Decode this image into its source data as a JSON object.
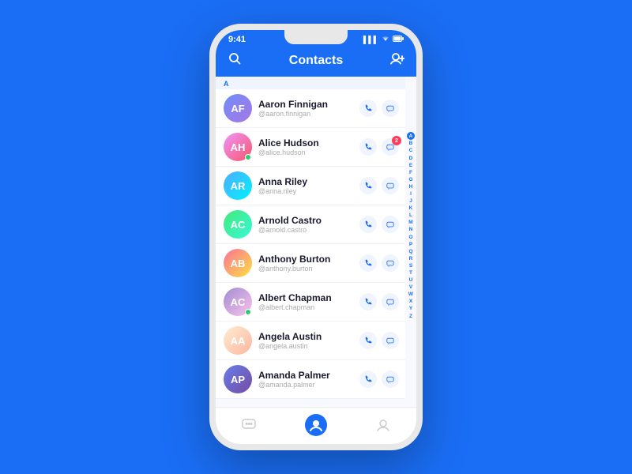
{
  "app": {
    "title": "Contacts"
  },
  "status_bar": {
    "time": "9:41",
    "signal": "▌▌▌",
    "wifi": "WiFi",
    "battery": "🔋"
  },
  "header": {
    "search_icon": "🔍",
    "add_icon": "👤+"
  },
  "contacts": [
    {
      "id": 1,
      "name": "Aaron Finnigan",
      "handle": "@aaron.finnigan",
      "online": false,
      "avatar_letter": "AF",
      "avatar_class": "av-1",
      "badge": null,
      "section": "A"
    },
    {
      "id": 2,
      "name": "Alice Hudson",
      "handle": "@alice.hudson",
      "online": true,
      "avatar_letter": "AH",
      "avatar_class": "av-2",
      "badge": "2",
      "section": null
    },
    {
      "id": 3,
      "name": "Anna Riley",
      "handle": "@anna.riley",
      "online": false,
      "avatar_letter": "AR",
      "avatar_class": "av-3",
      "badge": null,
      "section": null
    },
    {
      "id": 4,
      "name": "Arnold Castro",
      "handle": "@arnold.castro",
      "online": false,
      "avatar_letter": "AC",
      "avatar_class": "av-4",
      "badge": null,
      "section": null
    },
    {
      "id": 5,
      "name": "Anthony Burton",
      "handle": "@anthony.burton",
      "online": false,
      "avatar_letter": "AB",
      "avatar_class": "av-5",
      "badge": null,
      "section": null
    },
    {
      "id": 6,
      "name": "Albert Chapman",
      "handle": "@albert.chapman",
      "online": true,
      "avatar_letter": "AC",
      "avatar_class": "av-6",
      "badge": null,
      "section": null
    },
    {
      "id": 7,
      "name": "Angela Austin",
      "handle": "@angela.austin",
      "online": false,
      "avatar_letter": "AA",
      "avatar_class": "av-7",
      "badge": null,
      "section": null
    },
    {
      "id": 8,
      "name": "Amanda Palmer",
      "handle": "@amanda.palmer",
      "online": false,
      "avatar_letter": "AP",
      "avatar_class": "av-8",
      "badge": null,
      "section": null
    }
  ],
  "alphabet": [
    "A",
    "B",
    "C",
    "D",
    "E",
    "F",
    "G",
    "H",
    "I",
    "J",
    "K",
    "L",
    "M",
    "N",
    "O",
    "P",
    "Q",
    "R",
    "S",
    "T",
    "U",
    "V",
    "W",
    "X",
    "Y",
    "Z"
  ],
  "active_letter": "A",
  "nav": {
    "items": [
      {
        "icon": "💬",
        "label": "messages",
        "active": false
      },
      {
        "icon": "👤",
        "label": "contacts",
        "active": true
      },
      {
        "icon": "👁",
        "label": "profile",
        "active": false
      }
    ]
  }
}
